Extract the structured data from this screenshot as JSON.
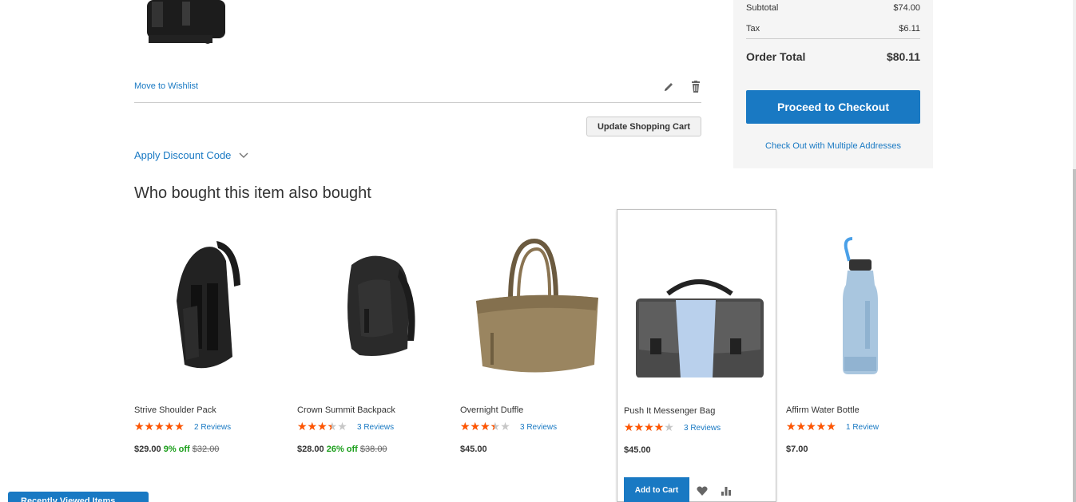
{
  "cart": {
    "move_to_wishlist": "Move to Wishlist",
    "update_cart": "Update Shopping Cart",
    "apply_discount": "Apply Discount Code"
  },
  "summary": {
    "subtotal_label": "Subtotal",
    "subtotal_value": "$74.00",
    "tax_label": "Tax",
    "tax_value": "$6.11",
    "total_label": "Order Total",
    "total_value": "$80.11",
    "checkout_label": "Proceed to Checkout",
    "multi_address_label": "Check Out with Multiple Addresses"
  },
  "crosssell": {
    "title": "Who bought this item also bought",
    "products": [
      {
        "name": "Strive Shoulder Pack",
        "rating": 0.9,
        "reviews": "2  Reviews",
        "price": "$29.00",
        "off": "9% off",
        "old": "$32.00"
      },
      {
        "name": "Crown Summit Backpack",
        "rating": 0.6,
        "reviews": "3  Reviews",
        "price": "$28.00",
        "off": "26% off",
        "old": "$38.00"
      },
      {
        "name": "Overnight Duffle",
        "rating": 0.6,
        "reviews": "3  Reviews",
        "price": "$45.00",
        "off": "",
        "old": ""
      },
      {
        "name": "Push It Messenger Bag",
        "rating": 0.7,
        "reviews": "3  Reviews",
        "price": "$45.00",
        "off": "",
        "old": "",
        "add_to_cart": "Add to Cart"
      },
      {
        "name": "Affirm Water Bottle",
        "rating": 1.0,
        "reviews": "1  Review",
        "price": "$7.00",
        "off": "",
        "old": ""
      }
    ]
  },
  "recently_viewed": "Recently Viewed Items",
  "colors": {
    "accent": "#1979c3",
    "star": "#ff5501",
    "discount": "#1a9e1a",
    "summary_bg": "#f5f5f5"
  }
}
